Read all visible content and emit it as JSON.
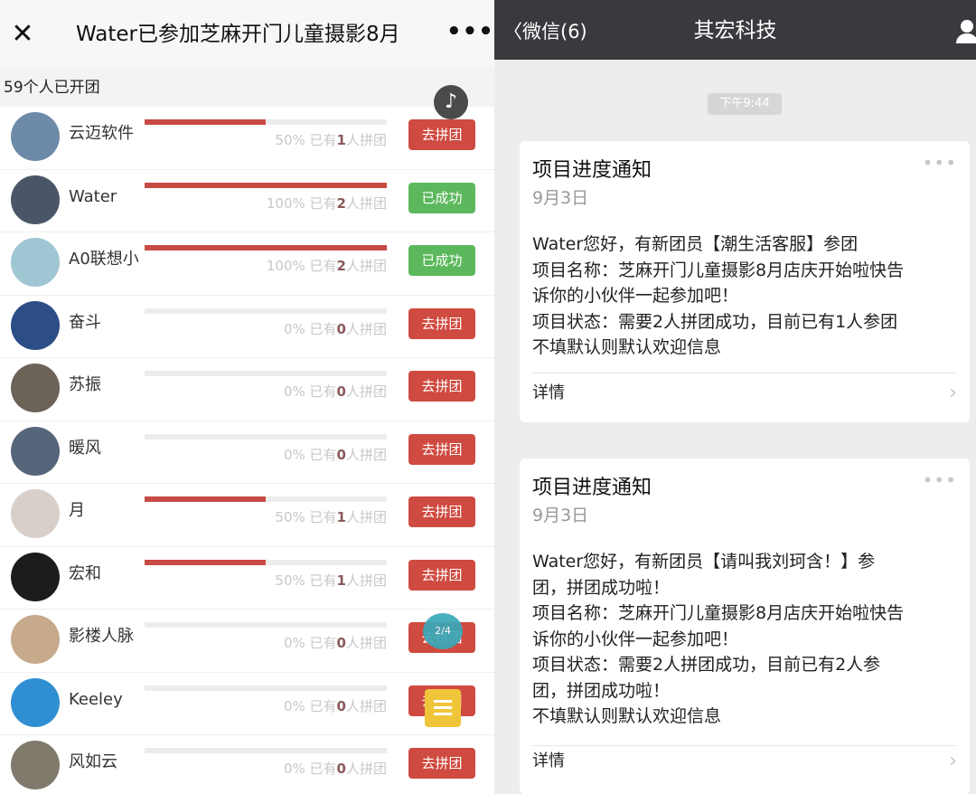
{
  "left_panel": {
    "header": {
      "close_icon": "close-x-icon",
      "title": "Water已参加芝麻开门儿童摄影8月",
      "more_icon": "more-dots-icon"
    },
    "count_text": "59个人已开团",
    "music_icon": "music-note-icon",
    "rows": [
      {
        "name": "云迈软件",
        "progress": 0.5,
        "pct": "50%",
        "pre": "已有",
        "count": "1",
        "post": "人拼团",
        "button": "去拼团",
        "status": "join",
        "avatar": "#6d8ba8"
      },
      {
        "name": "Water",
        "progress": 1.0,
        "pct": "100%",
        "pre": "已有",
        "count": "2",
        "post": "人拼团",
        "button": "已成功",
        "status": "done",
        "avatar": "#4a5668"
      },
      {
        "name": "A0联想小",
        "progress": 1.0,
        "pct": "100%",
        "pre": "已有",
        "count": "2",
        "post": "人拼团",
        "button": "已成功",
        "status": "done",
        "avatar": "#9fc6d2"
      },
      {
        "name": "奋斗",
        "progress": 0.0,
        "pct": "0%",
        "pre": "已有",
        "count": "0",
        "post": "人拼团",
        "button": "去拼团",
        "status": "join",
        "avatar": "#2c4d86"
      },
      {
        "name": "苏振",
        "progress": 0.0,
        "pct": "0%",
        "pre": "已有",
        "count": "0",
        "post": "人拼团",
        "button": "去拼团",
        "status": "join",
        "avatar": "#6b6258"
      },
      {
        "name": "暖风",
        "progress": 0.0,
        "pct": "0%",
        "pre": "已有",
        "count": "0",
        "post": "人拼团",
        "button": "去拼团",
        "status": "join",
        "avatar": "#55657a"
      },
      {
        "name": "月",
        "progress": 0.5,
        "pct": "50%",
        "pre": "已有",
        "count": "1",
        "post": "人拼团",
        "button": "去拼团",
        "status": "join",
        "avatar": "#d9cfca"
      },
      {
        "name": "宏和",
        "progress": 0.5,
        "pct": "50%",
        "pre": "已有",
        "count": "1",
        "post": "人拼团",
        "button": "去拼团",
        "status": "join",
        "avatar": "#1c1c1c"
      },
      {
        "name": "影楼人脉",
        "progress": 0.0,
        "pct": "0%",
        "pre": "已有",
        "count": "0",
        "post": "人拼团",
        "button": "去拼团",
        "status": "join",
        "avatar": "#c7a98c"
      },
      {
        "name": "Keeley",
        "progress": 0.0,
        "pct": "0%",
        "pre": "已有",
        "count": "0",
        "post": "人拼团",
        "button": "去拼团",
        "status": "join",
        "avatar": "#2f8fd2"
      },
      {
        "name": "风如云",
        "progress": 0.0,
        "pct": "0%",
        "pre": "已有",
        "count": "0",
        "post": "人拼团",
        "button": "去拼团",
        "status": "join",
        "avatar": "#7f7a6b"
      }
    ],
    "chat_icon": "chat-bubble-icon",
    "chat_label": "2/4",
    "doc_icon": "document-icon"
  },
  "right_panel": {
    "header": {
      "back_label": "〈微信(6)",
      "title": "其宏科技",
      "person_icon": "person-icon"
    },
    "time": "下午9:44",
    "messages": [
      {
        "title": "项目进度通知",
        "date": "9月3日",
        "lines": [
          "Water您好，有新团员【潮生活客服】参团",
          "项目名称：芝麻开门儿童摄影8月店庆开始啦快告",
          "诉你的小伙伴一起参加吧！",
          "项目状态：需要2人拼团成功，目前已有1人参团",
          "不填默认则默认欢迎信息"
        ],
        "detail": "详情"
      },
      {
        "title": "项目进度通知",
        "date": "9月3日",
        "lines": [
          "Water您好，有新团员【请叫我刘珂含！】参",
          "团，拼团成功啦！",
          "项目名称：芝麻开门儿童摄影8月店庆开始啦快告",
          "诉你的小伙伴一起参加吧！",
          "项目状态：需要2人拼团成功，目前已有2人参",
          "团，拼团成功啦！",
          "不填默认则默认欢迎信息"
        ],
        "detail": "详情"
      }
    ]
  }
}
